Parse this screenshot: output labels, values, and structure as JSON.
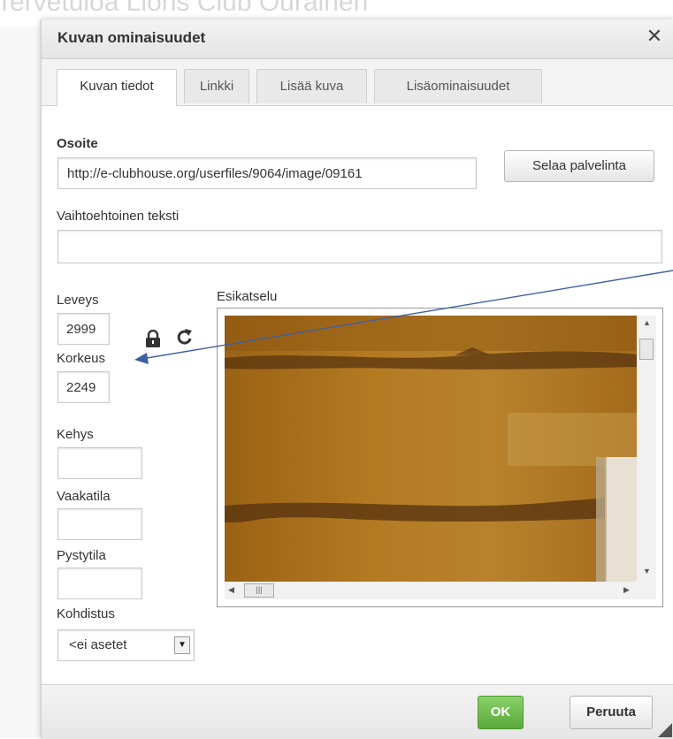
{
  "background": {
    "site_title": "Tervetuloa Lions Club Ouralnen"
  },
  "dialog": {
    "title": "Kuvan ominaisuudet",
    "close_symbol": "✕"
  },
  "tabs": [
    {
      "label": "Kuvan tiedot",
      "active": true
    },
    {
      "label": "Linkki",
      "active": false
    },
    {
      "label": "Lisää kuva",
      "active": false
    },
    {
      "label": "Lisäominaisuudet",
      "active": false
    }
  ],
  "form": {
    "url_label": "Osoite",
    "url_value": "http://e-clubhouse.org/userfiles/9064/image/09161",
    "browse_button": "Selaa palvelinta",
    "alt_label": "Vaihtoehtoinen teksti",
    "alt_value": "",
    "width_label": "Leveys",
    "width_value": "2999",
    "height_label": "Korkeus",
    "height_value": "2249",
    "border_label": "Kehys",
    "border_value": "",
    "hspace_label": "Vaakatila",
    "hspace_value": "",
    "vspace_label": "Pystytila",
    "vspace_value": "",
    "align_label": "Kohdistus",
    "align_value": "<ei asetet",
    "preview_label": "Esikatselu"
  },
  "footer": {
    "ok_button": "OK",
    "cancel_button": "Peruuta"
  },
  "colors": {
    "ok_green": "#5ba83a",
    "annotation_arrow": "#3f5f9f",
    "preview_wood": "#a86e17"
  },
  "icons": {
    "lock": "lock-icon",
    "reset": "reset-size-icon",
    "close": "close-icon",
    "resize": "resize-grip-icon"
  }
}
